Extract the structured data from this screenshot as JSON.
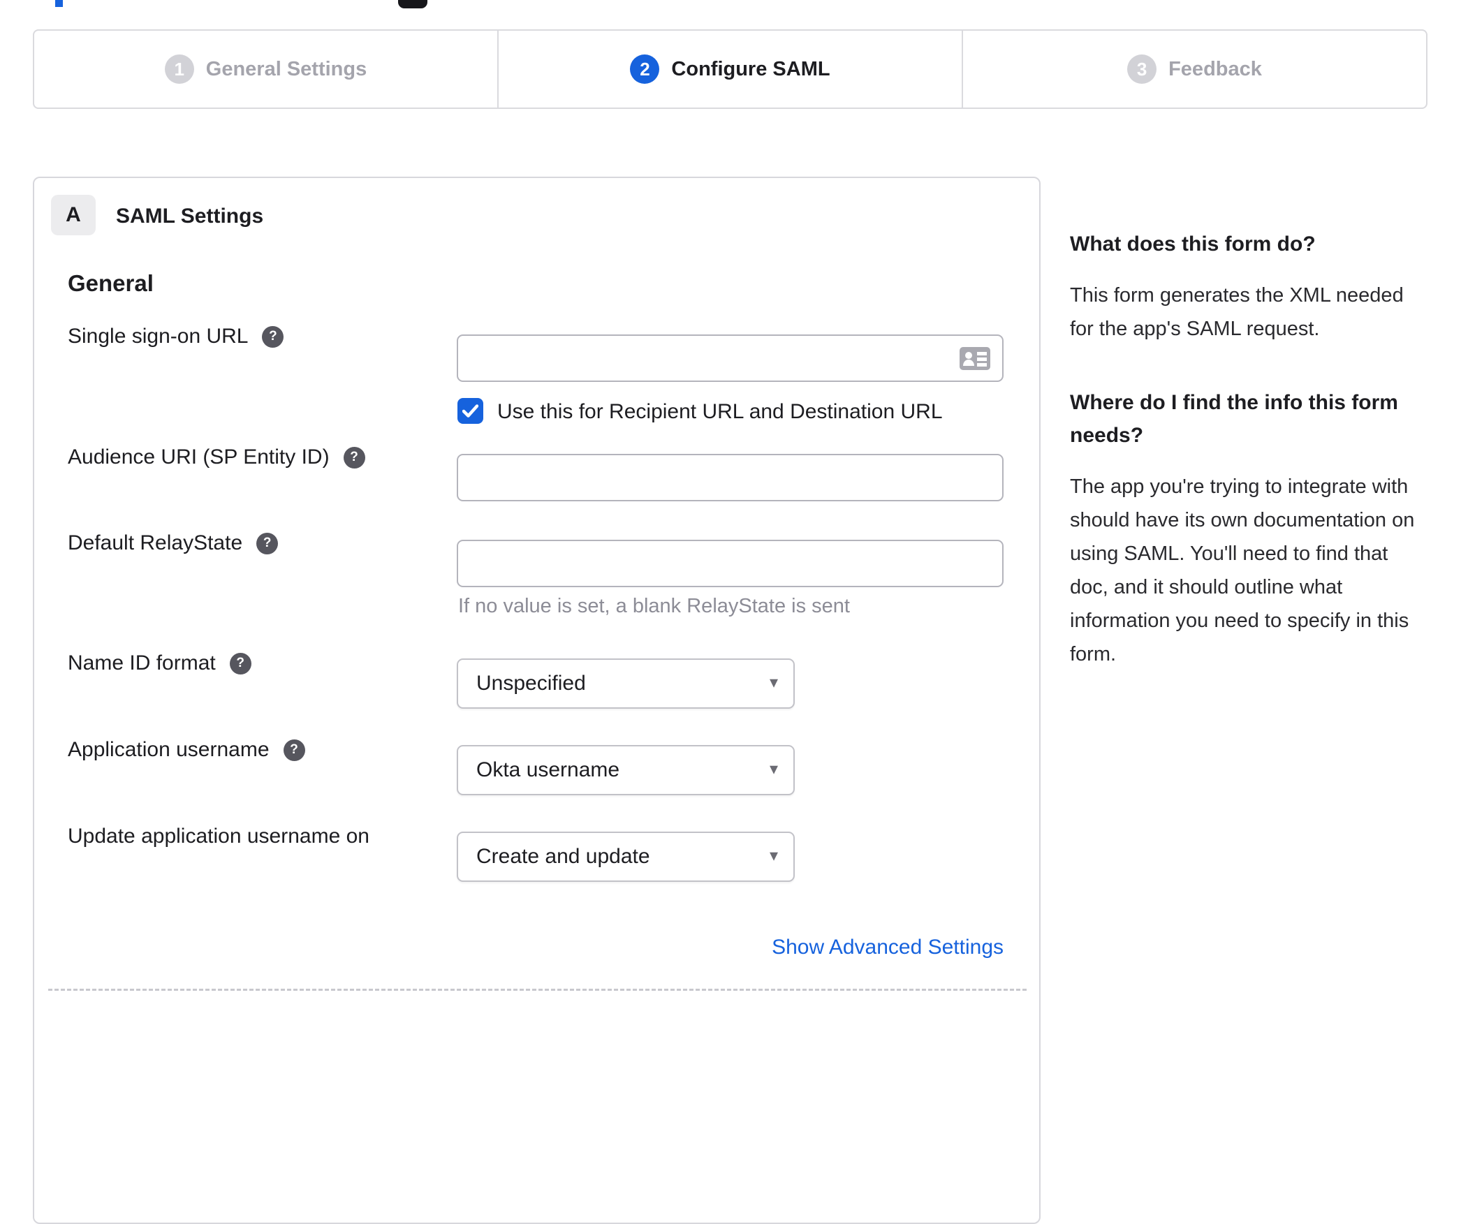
{
  "stepper": {
    "steps": [
      {
        "number": "1",
        "label": "General Settings",
        "state": "inactive"
      },
      {
        "number": "2",
        "label": "Configure SAML",
        "state": "current"
      },
      {
        "number": "3",
        "label": "Feedback",
        "state": "inactive"
      }
    ]
  },
  "saml_card": {
    "section_badge": "A",
    "section_title": "SAML Settings",
    "group_heading": "General",
    "fields": {
      "single_sign_on_url": {
        "label": "Single sign-on URL",
        "value": "",
        "checkbox": {
          "label": "Use this for Recipient URL and Destination URL",
          "checked": true
        }
      },
      "audience_uri": {
        "label": "Audience URI (SP Entity ID)",
        "value": ""
      },
      "default_relay_state": {
        "label": "Default RelayState",
        "value": "",
        "hint": "If no value is set, a blank RelayState is sent"
      },
      "name_id_format": {
        "label": "Name ID format",
        "selected": "Unspecified"
      },
      "application_username": {
        "label": "Application username",
        "selected": "Okta username"
      },
      "update_application_username_on": {
        "label": "Update application username on",
        "selected": "Create and update"
      }
    },
    "advanced_link": "Show Advanced Settings"
  },
  "sidebar": {
    "sections": [
      {
        "heading": "What does this form do?",
        "body": "This form generates the XML needed\nfor the app's SAML request."
      },
      {
        "heading": "Where do I find the info this form\nneeds?",
        "body": "The app you're trying to integrate with\nshould have its own documentation on\nusing SAML. You'll need to find that\ndoc, and it should outline what\ninformation you need to specify in this\nform."
      }
    ]
  },
  "icons": {
    "help_glyph": "?",
    "select_caret": "▾",
    "input_icon": "contact-card"
  },
  "colors": {
    "accent_blue": "#1662dd",
    "step_inactive_circle": "#d2d2d7",
    "panel_border": "#d7d7dc",
    "input_border": "#b4b4bc",
    "text_dark": "#1d1d21",
    "inactive_text": "#a4a4ac",
    "hint_gray": "#8c8c96",
    "help_icon_bg": "#56565e"
  }
}
